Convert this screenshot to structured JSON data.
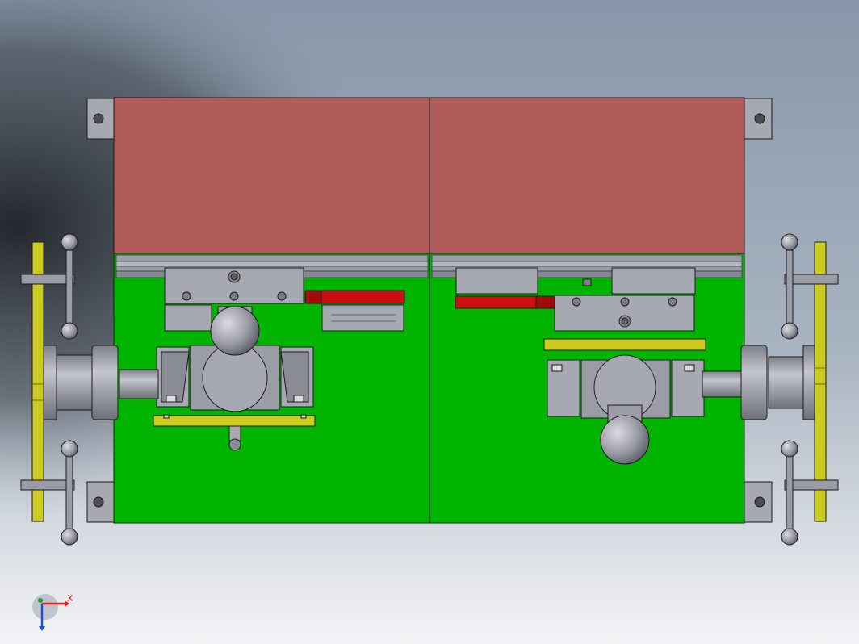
{
  "triad": {
    "x_label": "X",
    "x_color": "#e02020",
    "y_color": "#2050e0",
    "z_color": "#20a020"
  },
  "colors": {
    "bg_top": "#8a99ab",
    "bg_bottom": "#f2f3f5",
    "brown_plate": "#b05a5a",
    "green_plate": "#00b400",
    "steel": "#9a9ca6",
    "steel_dark": "#5d5f68",
    "yellow_part": "#cccc20",
    "red_part": "#cc1010",
    "outline": "#1a1a1a"
  }
}
